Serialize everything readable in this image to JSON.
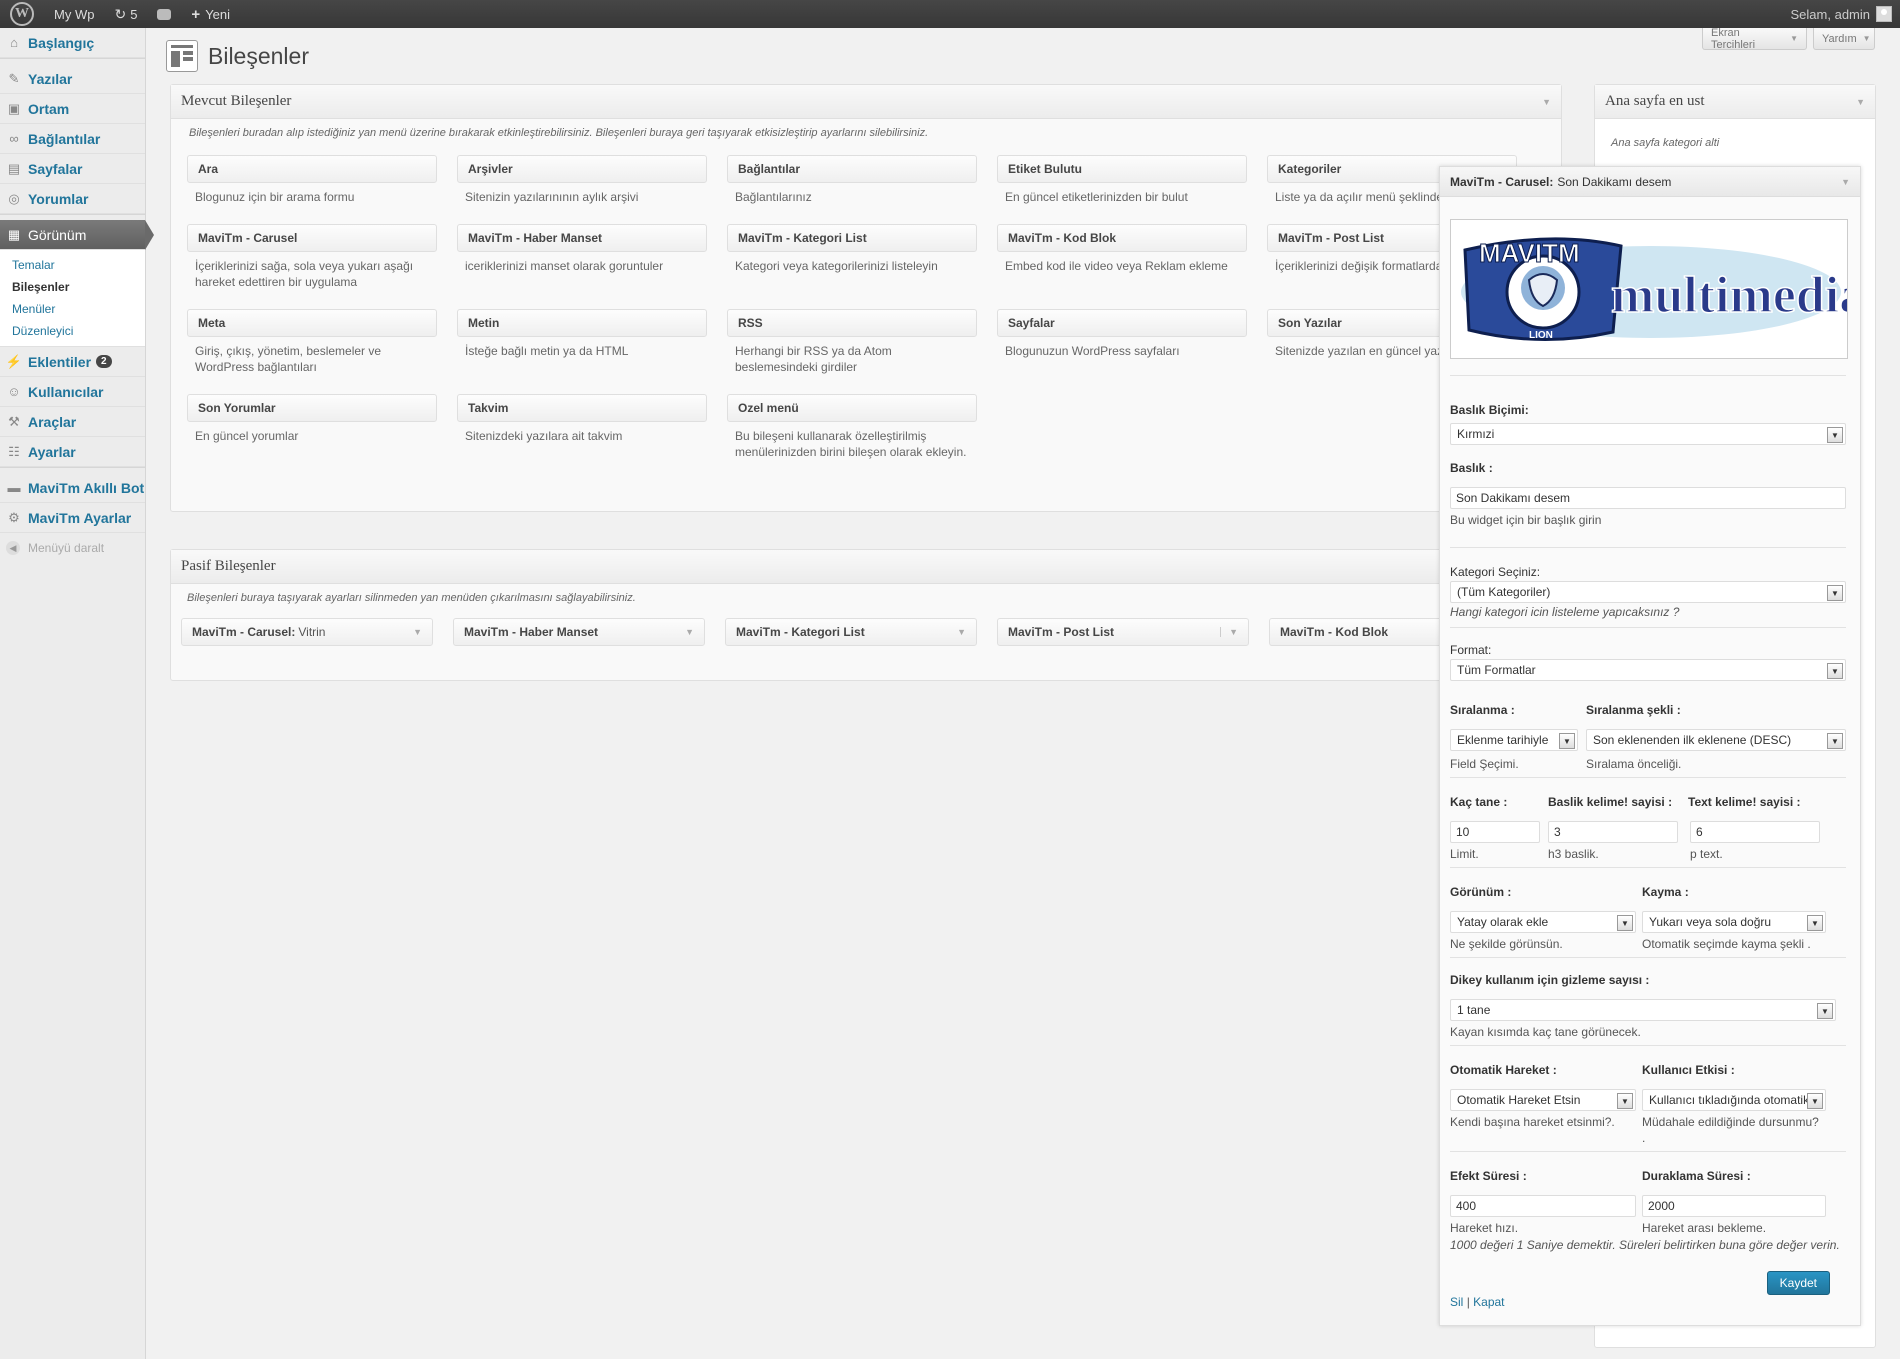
{
  "adminbar": {
    "site_name": "My Wp",
    "updates_count": "5",
    "new_label": "Yeni",
    "greeting": "Selam, admin"
  },
  "screen_meta": {
    "options_label": "Ekran Tercihleri",
    "help_label": "Yardım"
  },
  "sidebar": {
    "items": [
      {
        "label": "Başlangıç",
        "icon": "home-icon"
      },
      {
        "label": "Yazılar",
        "icon": "pin-icon"
      },
      {
        "label": "Ortam",
        "icon": "media-icon"
      },
      {
        "label": "Bağlantılar",
        "icon": "link-icon"
      },
      {
        "label": "Sayfalar",
        "icon": "page-icon"
      },
      {
        "label": "Yorumlar",
        "icon": "comment-icon"
      },
      {
        "label": "Görünüm",
        "icon": "appearance-icon"
      },
      {
        "label": "Eklentiler",
        "icon": "plugin-icon",
        "badge": "2"
      },
      {
        "label": "Kullanıcılar",
        "icon": "users-icon"
      },
      {
        "label": "Araçlar",
        "icon": "tools-icon"
      },
      {
        "label": "Ayarlar",
        "icon": "settings-icon"
      },
      {
        "label": "MaviTm Akıllı Bot",
        "icon": "bot-icon"
      },
      {
        "label": "MaviTm Ayarlar",
        "icon": "gear-icon"
      }
    ],
    "submenu": [
      "Temalar",
      "Bileşenler",
      "Menüler",
      "Düzenleyici"
    ],
    "collapse_label": "Menüyü daralt"
  },
  "page_title": "Bileşenler",
  "available": {
    "title": "Mevcut Bileşenler",
    "description": "Bileşenleri buradan alıp istediğiniz yan menü üzerine bırakarak etkinleştirebilirsiniz. Bileşenleri buraya geri taşıyarak etkisizleştirip ayarlarını silebilirsiniz.",
    "widgets": [
      {
        "title": "Ara",
        "desc": "Blogunuz için bir arama formu"
      },
      {
        "title": "Arşivler",
        "desc": "Sitenizin yazılarınının aylık arşivi"
      },
      {
        "title": "Bağlantılar",
        "desc": "Bağlantılarınız"
      },
      {
        "title": "Etiket Bulutu",
        "desc": "En güncel etiketlerinizden bir bulut"
      },
      {
        "title": "Kategoriler",
        "desc": "Liste ya da açılır menü şeklinde"
      },
      {
        "title": "MaviTm - Carusel",
        "desc": "İçeriklerinizi sağa, sola veya yukarı aşağı hareket edettiren bir uygulama"
      },
      {
        "title": "MaviTm - Haber Manset",
        "desc": "iceriklerinizi manset olarak goruntuler"
      },
      {
        "title": "MaviTm - Kategori List",
        "desc": "Kategori veya kategorilerinizi listeleyin"
      },
      {
        "title": "MaviTm - Kod Blok",
        "desc": "Embed kod ile video veya Reklam ekleme"
      },
      {
        "title": "MaviTm - Post List",
        "desc": "İçeriklerinizi değişik formatlarda"
      },
      {
        "title": "Meta",
        "desc": "Giriş, çıkış, yönetim, beslemeler ve WordPress bağlantıları"
      },
      {
        "title": "Metin",
        "desc": "İsteğe bağlı metin ya da HTML"
      },
      {
        "title": "RSS",
        "desc": "Herhangi bir RSS ya da Atom beslemesindeki girdiler"
      },
      {
        "title": "Sayfalar",
        "desc": "Blogunuzun WordPress sayfaları"
      },
      {
        "title": "Son Yazılar",
        "desc": "Sitenizde yazılan en güncel yazılar"
      },
      {
        "title": "Son Yorumlar",
        "desc": "En güncel yorumlar"
      },
      {
        "title": "Takvim",
        "desc": "Sitenizdeki yazılara ait takvim"
      },
      {
        "title": "Ozel menü",
        "desc": "Bu bileşeni kullanarak özelleştirilmiş menülerinizden birini bileşen olarak ekleyin."
      }
    ]
  },
  "inactive": {
    "title": "Pasif Bileşenler",
    "description": "Bileşenleri buraya taşıyarak ayarları silinmeden yan menüden çıkarılmasını sağlayabilirsiniz.",
    "widgets": [
      {
        "title": "MaviTm - Carusel:",
        "sub": "Vitrin"
      },
      {
        "title": "MaviTm - Haber Manset",
        "sub": ""
      },
      {
        "title": "MaviTm - Kategori List",
        "sub": ""
      },
      {
        "title": "MaviTm - Post List",
        "sub": ""
      },
      {
        "title": "MaviTm - Kod Blok",
        "sub": ""
      }
    ]
  },
  "sidebar_area": {
    "title": "Ana sayfa en ust",
    "description": "Ana sayfa kategori alti"
  },
  "editor": {
    "title": "MaviTm - Carusel:",
    "title_sub": "Son Dakikamı desem",
    "logo_text": "multimedia",
    "logo_badge": "MAVITM",
    "logo_sub": "LION",
    "heading_style_label": "Baslık Biçimi:",
    "heading_style_value": "Kırmızi",
    "title_label": "Baslık :",
    "title_value": "Son Dakikamı desem",
    "title_hint": "Bu widget için bir başlık girin",
    "category_label": "Kategori Seçiniz:",
    "category_value": "(Tüm Kategoriler)",
    "category_hint": "Hangi kategori icin listeleme yapıcaksınız ?",
    "format_label": "Format:",
    "format_value": "Tüm Formatlar",
    "order_label": "Sıralanma :",
    "order_value": "Eklenme tarihiyle",
    "order_hint": "Field Şeçimi.",
    "orderby_label": "Sıralanma şekli :",
    "orderby_value": "Son eklenenden ilk eklenene (DESC)",
    "orderby_hint": "Sıralama önceliği.",
    "count_label": "Kaç tane :",
    "count_value": "10",
    "count_hint": "Limit.",
    "title_words_label": "Baslik kelime! sayisi :",
    "title_words_value": "3",
    "title_words_hint": "h3 baslik.",
    "text_words_label": "Text kelime! sayisi :",
    "text_words_value": "6",
    "text_words_hint": "p text.",
    "view_label": "Görünüm :",
    "view_value": "Yatay olarak ekle",
    "view_hint": "Ne şekilde görünsün.",
    "scroll_label": "Kayma :",
    "scroll_value": "Yukarı veya sola doğru",
    "scroll_hint": "Otomatik seçimde kayma şekli .",
    "hide_label": "Dikey kullanım için gizleme sayısı :",
    "hide_value": "1 tane",
    "hide_hint": "Kayan kısımda kaç tane görünecek.",
    "auto_label": "Otomatik Hareket :",
    "auto_value": "Otomatik Hareket Etsin",
    "auto_hint": "Kendi başına hareket etsinmi?.",
    "user_label": "Kullanıcı Etkisi :",
    "user_value": "Kullanıcı tıkladığında otomatik",
    "user_hint": "Müdahale edildiğinde dursunmu?",
    "user_hint2": ".",
    "effect_label": "Efekt Süresi :",
    "effect_value": "400",
    "effect_hint": "Hareket hızı.",
    "pause_label": "Duraklama Süresi :",
    "pause_value": "2000",
    "pause_hint": "Hareket arası bekleme.",
    "timing_note": "1000 değeri 1 Saniye demektir. Süreleri belirtirken buna göre değer verin.",
    "delete_label": "Sil",
    "sep": "|",
    "close_label": "Kapat",
    "save_label": "Kaydet"
  }
}
